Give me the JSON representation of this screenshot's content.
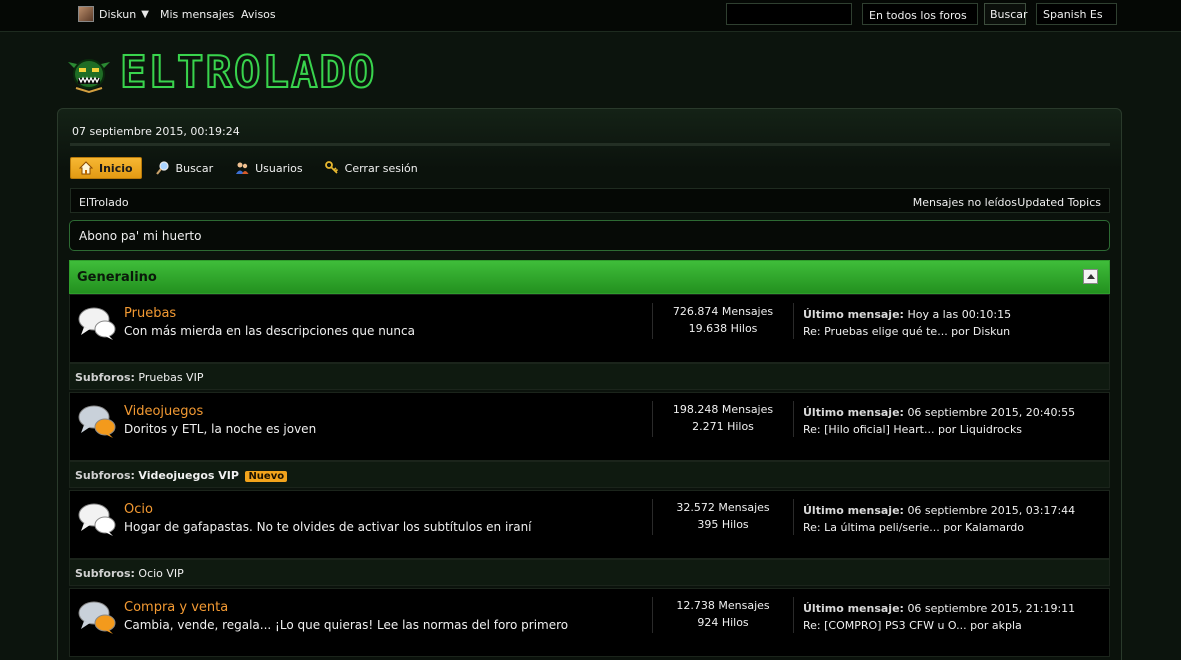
{
  "topbar": {
    "username": "Diskun",
    "my_messages": "Mis mensajes",
    "alerts": "Avisos",
    "search_value": "",
    "scope": "En todos los foros",
    "search_button": "Buscar",
    "language": "Spanish Es"
  },
  "logo": {
    "text": "ELTROLADO"
  },
  "datetime": "07 septiembre 2015, 00:19:24",
  "nav": [
    {
      "label": "Inicio",
      "icon": "home-icon"
    },
    {
      "label": "Buscar",
      "icon": "magnifier-icon"
    },
    {
      "label": "Usuarios",
      "icon": "users-icon"
    },
    {
      "label": "Cerrar sesión",
      "icon": "key-icon"
    }
  ],
  "breadcrumb": {
    "current": "ElTrolado",
    "unread": "Mensajes no leídos",
    "updated": "Updated Topics"
  },
  "announcement": "Abono pa' mi huerto",
  "category": {
    "title": "Generalino"
  },
  "forums": [
    {
      "title": "Pruebas",
      "desc": "Con más mierda en las descripciones que nunca",
      "posts": "726.874 Mensajes",
      "threads": "19.638 Hilos",
      "last_label": "Último mensaje:",
      "last_date": "Hoy a las 00:10:15",
      "last_post": "Re: Pruebas elige qué te... por Diskun",
      "subforum_label": "Subforos:",
      "subforum": "Pruebas VIP",
      "subforum_new": "",
      "icon_color": "#ffffff"
    },
    {
      "title": "Videojuegos",
      "desc": "Doritos y ETL, la noche es joven",
      "posts": "198.248 Mensajes",
      "threads": "2.271 Hilos",
      "last_label": "Último mensaje:",
      "last_date": "06 septiembre 2015, 20:40:55",
      "last_post": "Re: [Hilo oficial] Heart... por Liquidrocks",
      "subforum_label": "Subforos:",
      "subforum": "Videojuegos VIP",
      "subforum_new": "Nuevo",
      "icon_color": "#f39a1c"
    },
    {
      "title": "Ocio",
      "desc": "Hogar de gafapastas. No te olvides de activar los subtítulos en iraní",
      "posts": "32.572 Mensajes",
      "threads": "395 Hilos",
      "last_label": "Último mensaje:",
      "last_date": "06 septiembre 2015, 03:17:44",
      "last_post": "Re: La última peli/serie... por Kalamardo",
      "subforum_label": "Subforos:",
      "subforum": "Ocio VIP",
      "subforum_new": "",
      "icon_color": "#ffffff"
    },
    {
      "title": "Compra y venta",
      "desc": "Cambia, vende, regala... ¡Lo que quieras! Lee las normas del foro primero",
      "posts": "12.738 Mensajes",
      "threads": "924 Hilos",
      "last_label": "Último mensaje:",
      "last_date": "06 septiembre 2015, 21:19:11",
      "last_post": "Re: [COMPRO] PS3 CFW u O... por akpla",
      "icon_color": "#f39a1c"
    }
  ]
}
